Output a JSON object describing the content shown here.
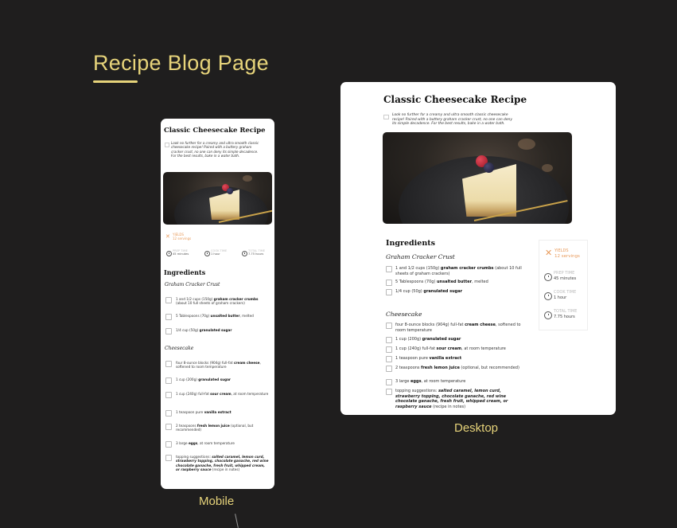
{
  "board": {
    "title": "Recipe Blog Page",
    "mobile_label": "Mobile",
    "desktop_label": "Desktop",
    "accent_color": "#e6d37a"
  },
  "recipe": {
    "title": "Classic Cheesecake Recipe",
    "intro": "Look no further for a creamy and ultra smooth classic cheesecake recipe! Paired with a buttery graham cracker crust, no one can deny its simple decadence. For the best results, bake in a water bath.",
    "yields_label": "YIELDS",
    "yields_value": "12 servings",
    "prep_label": "PREP TIME",
    "prep_value": "45 minutes",
    "cook_label": "COOK TIME",
    "cook_value": "1 hour",
    "total_label": "TOTAL TIME",
    "total_value": "7.75 hours",
    "ingredients_heading": "Ingredients",
    "crust_heading": "Graham Cracker Crust",
    "cheesecake_heading": "Cheesecake",
    "crust": [
      {
        "pre": "1 and 1/2 cups (150g) ",
        "bold": "graham cracker crumbs",
        "post": " (about 10 full sheets of graham crackers)"
      },
      {
        "pre": "5 Tablespoons (70g) ",
        "bold": "unsalted butter",
        "post": ", melted"
      },
      {
        "pre": "1/4 cup (50g) ",
        "bold": "granulated sugar",
        "post": ""
      }
    ],
    "cheesecake": [
      {
        "pre": "four 8-ounce blocks (904g) full-fat ",
        "bold": "cream cheese",
        "post": ", softened to room temperature"
      },
      {
        "pre": "1 cup (200g) ",
        "bold": "granulated sugar",
        "post": ""
      },
      {
        "pre": "1 cup (240g) full-fat ",
        "bold": "sour cream",
        "post": ", at room temperature"
      },
      {
        "pre": "1 teaspoon pure ",
        "bold": "vanilla extract",
        "post": ""
      },
      {
        "pre": "2 teaspoons ",
        "bold": "fresh lemon juice",
        "post": " (optional, but recommended)"
      },
      {
        "pre": "3 large ",
        "bold": "eggs",
        "post": ", at room temperature"
      },
      {
        "pre": "topping suggestions: ",
        "bold": "",
        "italic": "salted caramel, lemon curd, strawberry topping, chocolate ganache, red wine chocolate ganache, fresh fruit, whipped cream, or raspberry sauce",
        "post": " (recipe in notes)"
      }
    ]
  }
}
